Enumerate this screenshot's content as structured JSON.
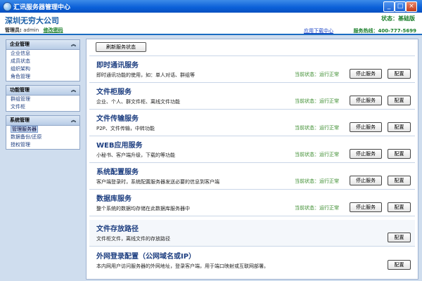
{
  "window": {
    "title": "汇讯服务器管理中心"
  },
  "header": {
    "company": "深圳无穷大公司",
    "admin_label": "管理员:",
    "admin_name": "admin",
    "change_password": "修改密码",
    "edition": "状态：基础版",
    "download_link": "应用下载中心",
    "hotline": "服务热线：400-777-5699"
  },
  "sidebar": {
    "groups": [
      {
        "title": "企业管理",
        "items": [
          "企业信息",
          "成员状态",
          "组织架构",
          "角色管理"
        ]
      },
      {
        "title": "功能管理",
        "items": [
          "群组管理",
          "文件柜"
        ]
      },
      {
        "title": "系统管理",
        "items": [
          "管理服务器",
          "数据备份/还原",
          "授权管理"
        ]
      }
    ],
    "active_item": "管理服务器"
  },
  "toolbar": {
    "refresh_label": "刷新服务状态"
  },
  "services": [
    {
      "name": "即时通讯服务",
      "desc": "即时通讯功能的使用，如：单人对话、群组等",
      "state": "当前状态：运行正常",
      "stop": "停止服务",
      "config": "配置"
    },
    {
      "name": "文件柜服务",
      "desc": "企业、个人、群文件柜、离线文件功能",
      "state": "当前状态：运行正常",
      "stop": "停止服务",
      "config": "配置"
    },
    {
      "name": "文件传输服务",
      "desc": "P2P、文件传输，中转功能",
      "state": "当前状态：运行正常",
      "stop": "停止服务",
      "config": "配置"
    },
    {
      "name": "WEB应用服务",
      "desc": "小秘书、客户端升级，下载的等功能",
      "state": "当前状态：运行正常",
      "stop": "停止服务",
      "config": "配置"
    },
    {
      "name": "系统配置服务",
      "desc": "客户端登录时，系统配置服务器发送必要的信息到客户端",
      "state": "当前状态：运行正常",
      "stop": "停止服务",
      "config": "配置"
    },
    {
      "name": "数据库服务",
      "desc": "整个系统的数据均存储在此数据库服务器中",
      "state": "当前状态：运行正常",
      "stop": "停止服务",
      "config": "配置"
    },
    {
      "name": "文件存放路径",
      "desc": "文件柜文件，离线文件的存放路径",
      "config": "配置"
    },
    {
      "name": "外网登录配置（公网域名或IP）",
      "desc": "本内网用户访问服务器的外网地址，登录客户端，用于端口映射或互联网部署。",
      "config": "配置"
    }
  ],
  "colors": {
    "titlebar": "#0a5fd8",
    "accent_green": "#1a7f2b",
    "link_blue": "#1c46c7",
    "frame": "#cfddee"
  }
}
